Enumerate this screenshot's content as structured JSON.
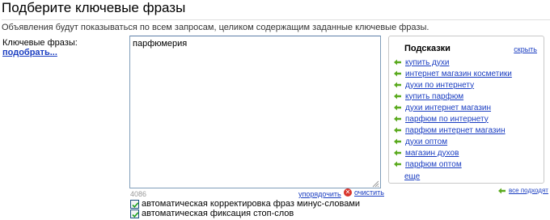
{
  "header": {
    "title": "Подберите ключевые фразы",
    "subtitle": "Объявления будут показываться по всем запросам, целиком содержащим заданные ключевые фразы."
  },
  "keywords": {
    "label": "Ключевые фразы:",
    "pick_link": "подобрать...",
    "value": "парфюмерия",
    "counter": "4086",
    "sort_link": "упорядочить",
    "clear_link": "очистить",
    "clear_icon": "close-circle-icon"
  },
  "options": {
    "auto_correct": {
      "label": "автоматическая корректировка фраз минус-словами",
      "checked": true
    },
    "auto_stopwords": {
      "label": "автоматическая фиксация стоп-слов",
      "checked": true
    }
  },
  "hints": {
    "title": "Подсказки",
    "hide_link": "скрыть",
    "arrow_icon": "green-left-arrow-icon",
    "arrow_color": "#5aaa1e",
    "items": [
      "купить духи",
      "интернет магазин косметики",
      "духи по интернету",
      "купить парфюм",
      "духи интернет магазин",
      "парфюм по интернету",
      "парфюм интернет магазин",
      "духи оптом",
      "магазин духов",
      "парфюм оптом"
    ],
    "more_link": "еще",
    "all_up_link": "все подходят"
  },
  "colors": {
    "link": "#1a3dc1",
    "accent_green": "#5aaa1e",
    "clear_red": "#d9352b"
  }
}
